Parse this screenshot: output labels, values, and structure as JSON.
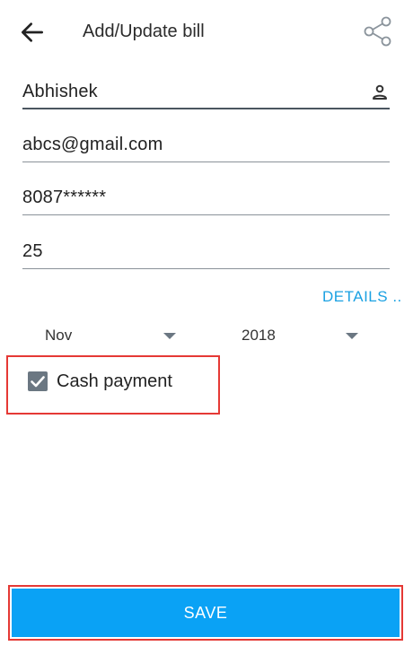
{
  "header": {
    "title": "Add/Update bill"
  },
  "form": {
    "name_value": "Abhishek",
    "email_value": "abcs@gmail.com",
    "phone_value": "8087******",
    "amount_value": "25",
    "details_link": "DETAILS .."
  },
  "period": {
    "month_selected": "Nov",
    "year_selected": "2018"
  },
  "payment": {
    "cash_label": "Cash payment",
    "cash_checked": true
  },
  "actions": {
    "save_label": "SAVE"
  },
  "colors": {
    "accent": "#0aa2f5",
    "link": "#1ba1e2",
    "highlight_border": "#e53935",
    "checkbox": "#6b7782"
  }
}
